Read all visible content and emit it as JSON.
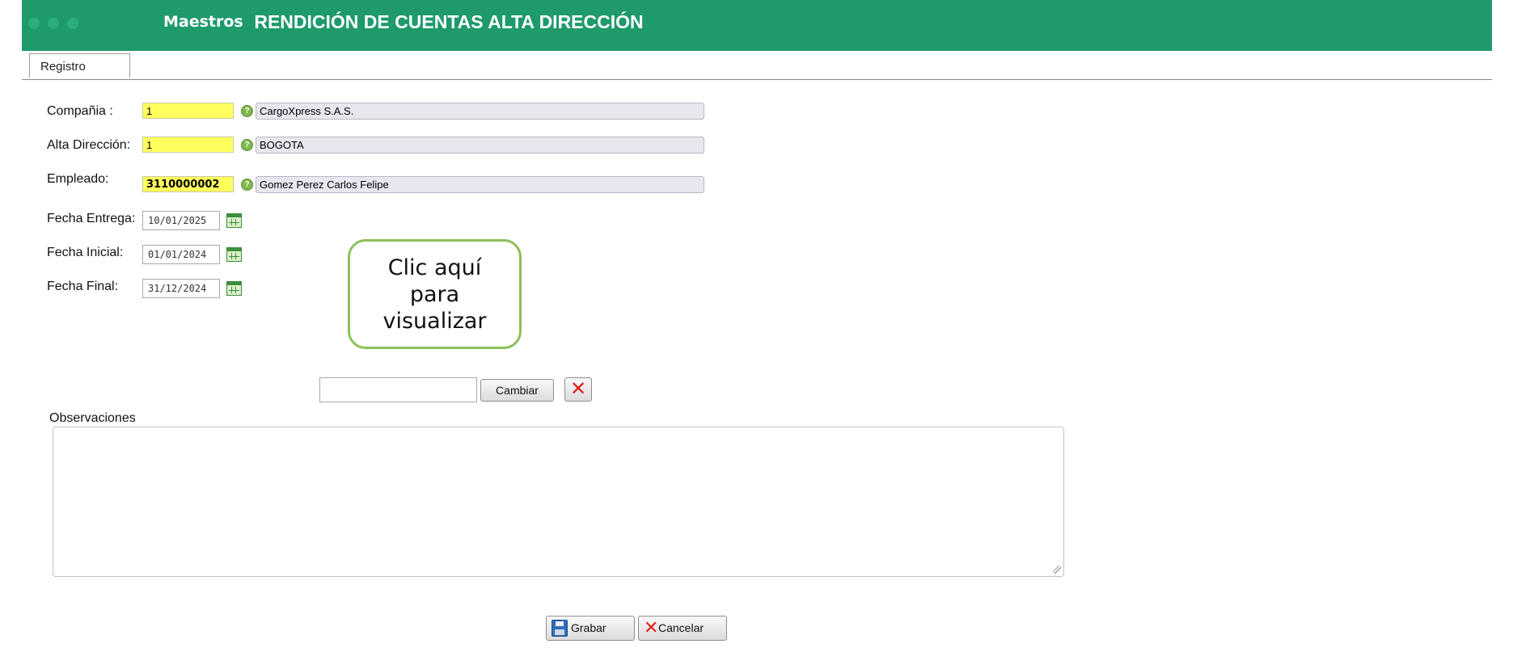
{
  "header": {
    "menu_label": "Maestros",
    "title": "RENDICIÓN DE CUENTAS ALTA DIRECCIÓN",
    "bg_color": "#1e9a6b"
  },
  "tabs": [
    {
      "label": "Registro",
      "active": true
    }
  ],
  "form": {
    "compania": {
      "label": "Compañia :",
      "code": "1",
      "description": "CargoXpress S.A.S."
    },
    "alta_direccion": {
      "label": "Alta Dirección:",
      "code": "1",
      "description": "BOGOTA"
    },
    "empleado": {
      "label": "Empleado:",
      "code": "3110000002",
      "description": "Gomez Perez Carlos Felipe"
    },
    "fecha_entrega": {
      "label": "Fecha Entrega:",
      "value": "10/01/2025"
    },
    "fecha_inicial": {
      "label": "Fecha Inicial:",
      "value": "01/01/2024"
    },
    "fecha_final": {
      "label": "Fecha Final:",
      "value": "31/12/2024"
    }
  },
  "callout": {
    "line1": "Clic aquí",
    "line2": "para",
    "line3": "visualizar"
  },
  "attachment": {
    "change_button_label": "Cambiar",
    "remove_icon": "close-icon"
  },
  "observaciones": {
    "label": "Observaciones",
    "value": ""
  },
  "actions": {
    "save_label": "Grabar",
    "cancel_label": "Cancelar"
  }
}
